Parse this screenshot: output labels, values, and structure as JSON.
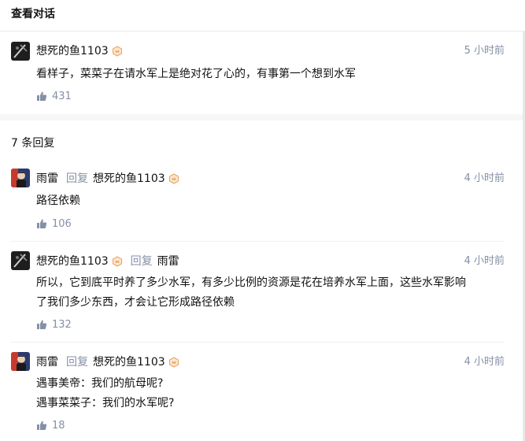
{
  "header": {
    "title": "查看对话"
  },
  "main_comment": {
    "author": "想死的鱼1103",
    "time": "5 小时前",
    "content": "看样子，菜菜子在请水军上是绝对花了心的，有事第一个想到水军",
    "likes": "431"
  },
  "reply_count_label": "7 条回复",
  "reply_word": "回复",
  "replies": [
    {
      "author": "雨雷",
      "reply_to": "想死的鱼1103",
      "time": "4 小时前",
      "lines": [
        "路径依赖"
      ],
      "likes": "106"
    },
    {
      "author": "想死的鱼1103",
      "reply_to": "雨雷",
      "time": "4 小时前",
      "lines": [
        "所以，它到底平时养了多少水军，有多少比例的资源是花在培养水军上面，这些水军影响",
        "了我们多少东西，才会让它形成路径依赖"
      ],
      "likes": "132"
    },
    {
      "author": "雨雷",
      "reply_to": "想死的鱼1103",
      "time": "4 小时前",
      "lines": [
        "遇事美帝：我们的航母呢?",
        "遇事菜菜子：我们的水军呢?"
      ],
      "likes": "18"
    }
  ],
  "colors": {
    "muted": "#8590a6",
    "badge": "#e8a25a",
    "text": "#121212"
  }
}
